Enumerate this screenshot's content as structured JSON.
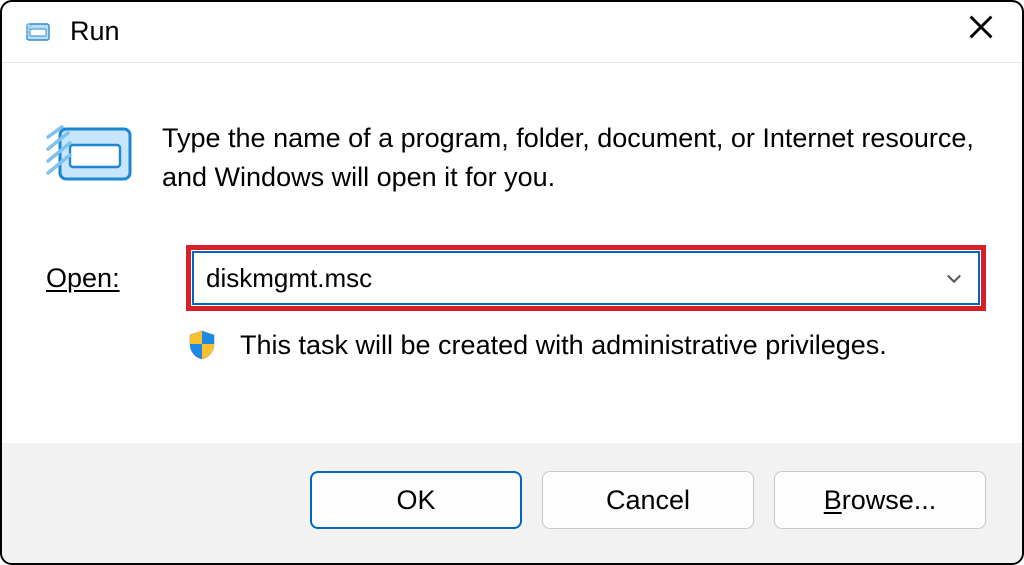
{
  "titlebar": {
    "title": "Run"
  },
  "description": "Type the name of a program, folder, document, or Internet resource, and Windows will open it for you.",
  "open": {
    "label_first": "O",
    "label_rest": "pen:",
    "value": "diskmgmt.msc"
  },
  "admin_notice": "This task will be created with administrative privileges.",
  "buttons": {
    "ok": "OK",
    "cancel": "Cancel",
    "browse_first": "B",
    "browse_rest": "rowse..."
  }
}
